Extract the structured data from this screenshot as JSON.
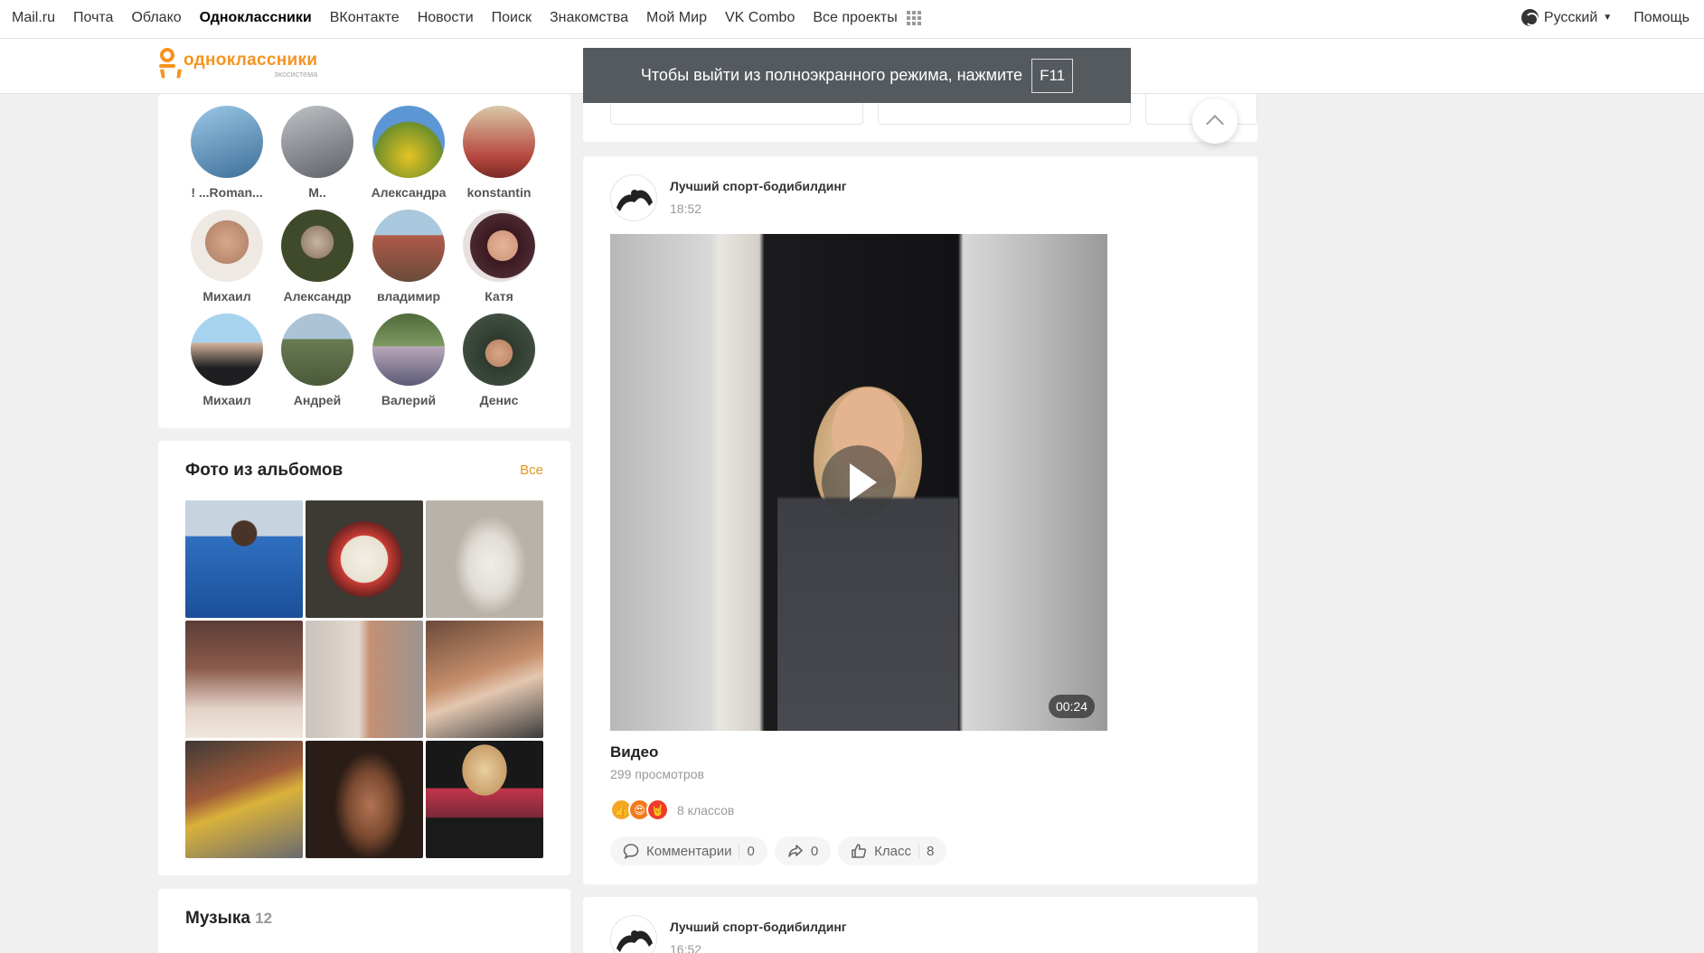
{
  "portal": {
    "links": [
      "Mail.ru",
      "Почта",
      "Облако",
      "Одноклассники",
      "ВКонтакте",
      "Новости",
      "Поиск",
      "Знакомства",
      "Мой Мир",
      "VK Combo",
      "Все проекты"
    ],
    "active": "Одноклассники",
    "language": "Русский",
    "help": "Помощь"
  },
  "logo": {
    "title": "одноклассники",
    "subtitle": "экосистема"
  },
  "fullscreen_notice": {
    "text": "Чтобы выйти из полноэкранного режима, нажмите",
    "key": "F11"
  },
  "friends": [
    {
      "name": "! ...Roman...",
      "color": "#6fa7cf"
    },
    {
      "name": "M..",
      "color": "#8b8f95"
    },
    {
      "name": "Александра",
      "color": "#c9a928"
    },
    {
      "name": "konstantin",
      "color": "#b7493f"
    },
    {
      "name": "Михаил",
      "color": "#c6a28c"
    },
    {
      "name": "Александр",
      "color": "#4f5d3a"
    },
    {
      "name": "владимир",
      "color": "#8a6b5a"
    },
    {
      "name": "Катя",
      "color": "#6b2e3a"
    },
    {
      "name": "Михаил",
      "color": "#7aa8c7"
    },
    {
      "name": "Андрей",
      "color": "#7d8f6e"
    },
    {
      "name": "Валерий",
      "color": "#6a7f5c"
    },
    {
      "name": "Денис",
      "color": "#4a5b4c"
    }
  ],
  "albums": {
    "title": "Фото из альбомов",
    "all_link": "Все",
    "photos": [
      {
        "color": "#2a5fa8"
      },
      {
        "color": "#7a7f6a"
      },
      {
        "color": "#d8d4cc"
      },
      {
        "color": "#8a5a4a"
      },
      {
        "color": "#b7a9a0"
      },
      {
        "color": "#9b6a4e"
      },
      {
        "color": "#5a4a42"
      },
      {
        "color": "#4a3528"
      },
      {
        "color": "#7a2a3a"
      }
    ]
  },
  "music": {
    "title": "Музыка",
    "count": "12"
  },
  "post": {
    "group": "Лучший спорт-бодибилдинг",
    "time": "18:52",
    "duration": "00:24",
    "title": "Видео",
    "views": "299 просмотров",
    "classes": "8 классов",
    "comments_label": "Комментарии",
    "comments_count": "0",
    "shares_count": "0",
    "like_label": "Класс",
    "like_count": "8"
  },
  "post2": {
    "group": "Лучший спорт-бодибилдинг",
    "time": "16:52"
  }
}
